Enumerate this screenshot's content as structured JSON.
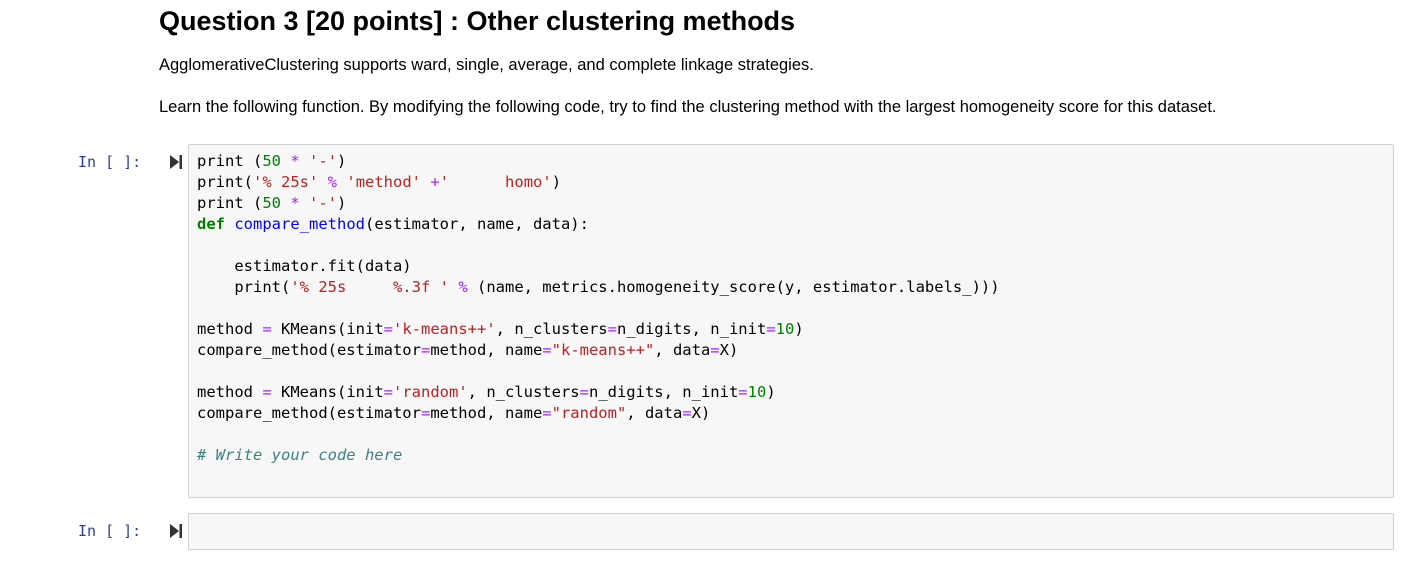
{
  "markdown": {
    "heading": "Question 3 [20 points] : Other clustering methods",
    "para1": "AgglomerativeClustering supports ward, single, average, and complete linkage strategies.",
    "para2": "Learn the following function. By modifying the following code, try to find the clustering method with the largest homogeneity score for this dataset."
  },
  "cells": [
    {
      "prompt": "In [ ]:",
      "run_icon": "run-cell-icon",
      "lines": [
        [
          {
            "t": "print (",
            "c": ""
          },
          {
            "t": "50",
            "c": "num"
          },
          {
            "t": " ",
            "c": ""
          },
          {
            "t": "*",
            "c": "op"
          },
          {
            "t": " ",
            "c": ""
          },
          {
            "t": "'-'",
            "c": "str"
          },
          {
            "t": ")",
            "c": ""
          }
        ],
        [
          {
            "t": "print(",
            "c": ""
          },
          {
            "t": "'% 25s'",
            "c": "str"
          },
          {
            "t": " ",
            "c": ""
          },
          {
            "t": "%",
            "c": "op"
          },
          {
            "t": " ",
            "c": ""
          },
          {
            "t": "'method'",
            "c": "str"
          },
          {
            "t": " ",
            "c": ""
          },
          {
            "t": "+",
            "c": "op"
          },
          {
            "t": "'      homo'",
            "c": "str"
          },
          {
            "t": ")",
            "c": ""
          }
        ],
        [
          {
            "t": "print (",
            "c": ""
          },
          {
            "t": "50",
            "c": "num"
          },
          {
            "t": " ",
            "c": ""
          },
          {
            "t": "*",
            "c": "op"
          },
          {
            "t": " ",
            "c": ""
          },
          {
            "t": "'-'",
            "c": "str"
          },
          {
            "t": ")",
            "c": ""
          }
        ],
        [
          {
            "t": "def",
            "c": "kw"
          },
          {
            "t": " ",
            "c": ""
          },
          {
            "t": "compare_method",
            "c": "fn"
          },
          {
            "t": "(estimator, name, data):",
            "c": ""
          }
        ],
        [
          {
            "t": "",
            "c": ""
          }
        ],
        [
          {
            "t": "    estimator.fit(data)",
            "c": ""
          }
        ],
        [
          {
            "t": "    print(",
            "c": ""
          },
          {
            "t": "'% 25s     %.3f '",
            "c": "str"
          },
          {
            "t": " ",
            "c": ""
          },
          {
            "t": "%",
            "c": "op"
          },
          {
            "t": " (name, metrics.homogeneity_score(y, estimator.labels_)))",
            "c": ""
          }
        ],
        [
          {
            "t": "",
            "c": ""
          }
        ],
        [
          {
            "t": "method ",
            "c": ""
          },
          {
            "t": "=",
            "c": "op"
          },
          {
            "t": " KMeans(init",
            "c": ""
          },
          {
            "t": "=",
            "c": "op"
          },
          {
            "t": "'k-means++'",
            "c": "str"
          },
          {
            "t": ", n_clusters",
            "c": ""
          },
          {
            "t": "=",
            "c": "op"
          },
          {
            "t": "n_digits, n_init",
            "c": ""
          },
          {
            "t": "=",
            "c": "op"
          },
          {
            "t": "10",
            "c": "num"
          },
          {
            "t": ")",
            "c": ""
          }
        ],
        [
          {
            "t": "compare_method(estimator",
            "c": ""
          },
          {
            "t": "=",
            "c": "op"
          },
          {
            "t": "method, name",
            "c": ""
          },
          {
            "t": "=",
            "c": "op"
          },
          {
            "t": "\"k-means++\"",
            "c": "str"
          },
          {
            "t": ", data",
            "c": ""
          },
          {
            "t": "=",
            "c": "op"
          },
          {
            "t": "X)",
            "c": ""
          }
        ],
        [
          {
            "t": "",
            "c": ""
          }
        ],
        [
          {
            "t": "method ",
            "c": ""
          },
          {
            "t": "=",
            "c": "op"
          },
          {
            "t": " KMeans(init",
            "c": ""
          },
          {
            "t": "=",
            "c": "op"
          },
          {
            "t": "'random'",
            "c": "str"
          },
          {
            "t": ", n_clusters",
            "c": ""
          },
          {
            "t": "=",
            "c": "op"
          },
          {
            "t": "n_digits, n_init",
            "c": ""
          },
          {
            "t": "=",
            "c": "op"
          },
          {
            "t": "10",
            "c": "num"
          },
          {
            "t": ")",
            "c": ""
          }
        ],
        [
          {
            "t": "compare_method(estimator",
            "c": ""
          },
          {
            "t": "=",
            "c": "op"
          },
          {
            "t": "method, name",
            "c": ""
          },
          {
            "t": "=",
            "c": "op"
          },
          {
            "t": "\"random\"",
            "c": "str"
          },
          {
            "t": ", data",
            "c": ""
          },
          {
            "t": "=",
            "c": "op"
          },
          {
            "t": "X)",
            "c": ""
          }
        ],
        [
          {
            "t": "",
            "c": ""
          }
        ],
        [
          {
            "t": "# Write your code here",
            "c": "cm"
          }
        ]
      ]
    },
    {
      "prompt": "In [ ]:",
      "run_icon": "run-cell-icon",
      "lines": []
    }
  ],
  "colors": {
    "prompt": "#303f9f",
    "cell_bg": "#f7f7f7",
    "cell_border": "#cfcfcf"
  }
}
